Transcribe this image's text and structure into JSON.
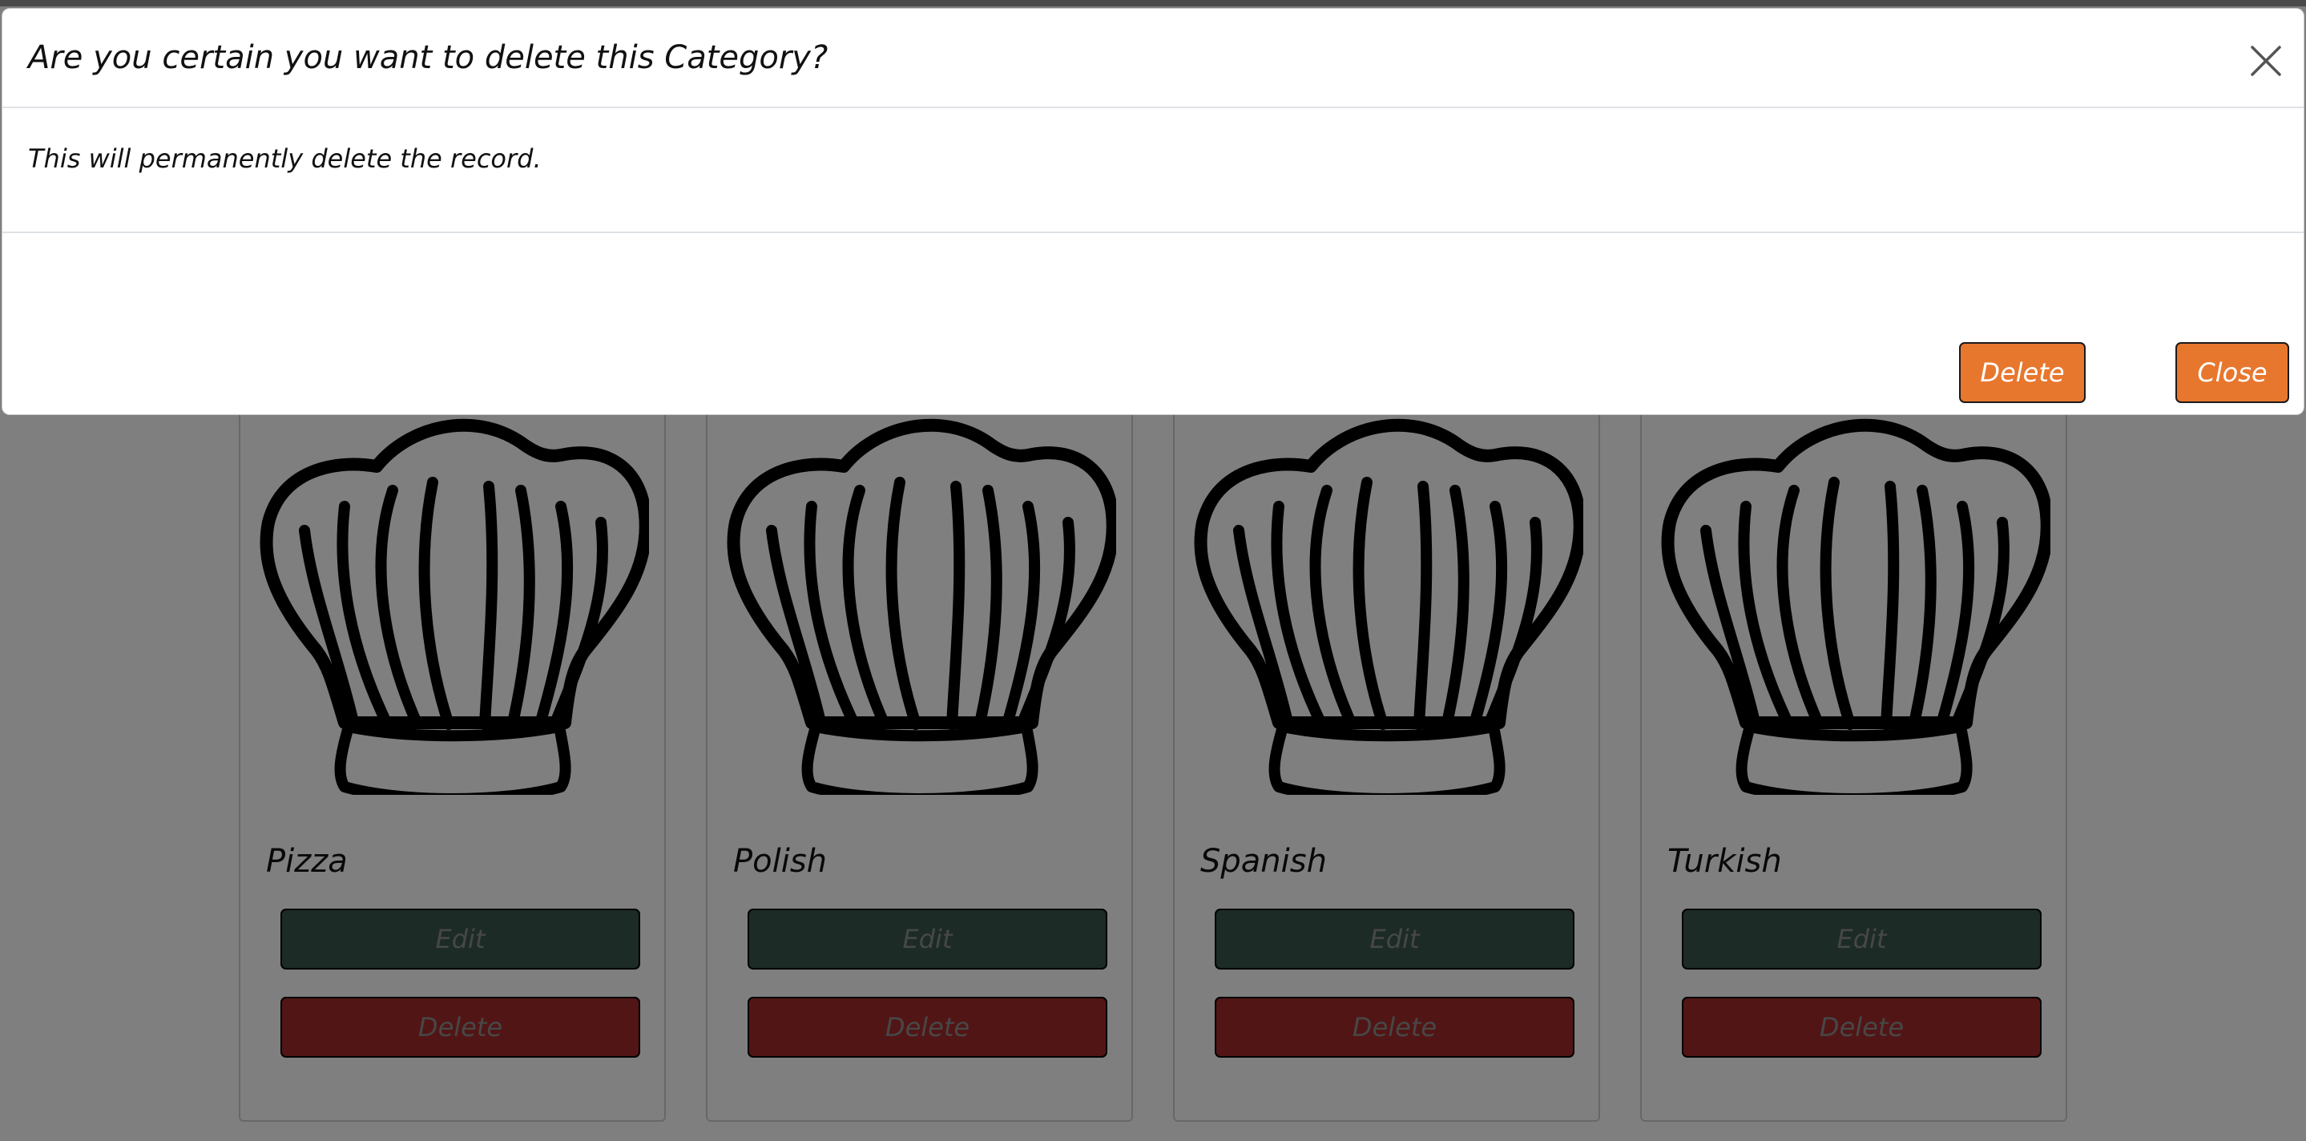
{
  "modal": {
    "title": "Are you certain you want to delete this Category?",
    "body": "This will permanently delete the record.",
    "delete_label": "Delete",
    "close_label": "Close",
    "close_icon": "close-icon",
    "accent_color": "#e8772e"
  },
  "cards": [
    {
      "title": "Pizza",
      "edit_label": "Edit",
      "delete_label": "Delete",
      "image_icon": "chef-hat-icon"
    },
    {
      "title": "Polish",
      "edit_label": "Edit",
      "delete_label": "Delete",
      "image_icon": "chef-hat-icon"
    },
    {
      "title": "Spanish",
      "edit_label": "Edit",
      "delete_label": "Delete",
      "image_icon": "chef-hat-icon"
    },
    {
      "title": "Turkish",
      "edit_label": "Edit",
      "delete_label": "Delete",
      "image_icon": "chef-hat-icon"
    }
  ],
  "colors": {
    "edit_button": "#38574a",
    "delete_button": "#a52b2b",
    "overlay": "rgba(0,0,0,0.5)"
  }
}
